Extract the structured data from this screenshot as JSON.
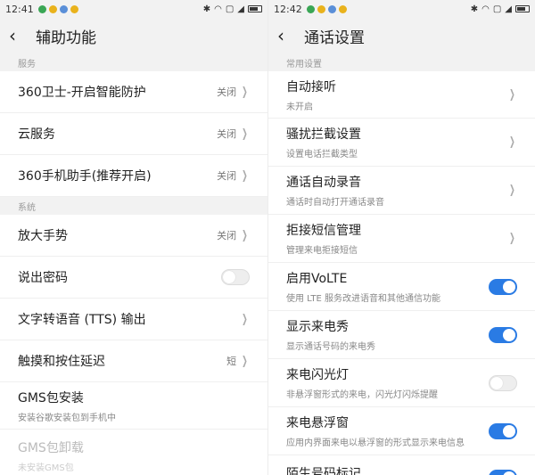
{
  "left": {
    "status": {
      "time": "12:41"
    },
    "title": "辅助功能",
    "sections": {
      "services": "服务",
      "system": "系统"
    },
    "rows": {
      "guard360": {
        "label": "360卫士-开启智能防护",
        "value": "关闭"
      },
      "cloud": {
        "label": "云服务",
        "value": "关闭"
      },
      "assistant360": {
        "label": "360手机助手(推荐开启)",
        "value": "关闭"
      },
      "magnify": {
        "label": "放大手势",
        "value": "关闭"
      },
      "speak_password": {
        "label": "说出密码",
        "toggle": false
      },
      "tts": {
        "label": "文字转语音 (TTS) 输出"
      },
      "touch_delay": {
        "label": "触摸和按住延迟",
        "value": "短"
      },
      "gms_install": {
        "label": "GMS包安装",
        "sub": "安装谷歌安装包到手机中"
      },
      "gms_uninstall": {
        "label": "GMS包卸载",
        "sub": "未安装GMS包"
      }
    }
  },
  "right": {
    "status": {
      "time": "12:42"
    },
    "title": "通话设置",
    "sections": {
      "common": "常用设置"
    },
    "rows": {
      "auto_answer": {
        "label": "自动接听",
        "sub": "未开启"
      },
      "harass": {
        "label": "骚扰拦截设置",
        "sub": "设置电话拦截类型"
      },
      "auto_record": {
        "label": "通话自动录音",
        "sub": "通话时自动打开通话录音"
      },
      "reject_sms": {
        "label": "拒接短信管理",
        "sub": "管理来电拒接短信"
      },
      "volte": {
        "label": "启用VoLTE",
        "sub": "使用 LTE 服务改进语音和其他通信功能",
        "toggle": true
      },
      "caller_show": {
        "label": "显示来电秀",
        "sub": "显示通话号码的来电秀",
        "toggle": true
      },
      "flash": {
        "label": "来电闪光灯",
        "sub": "非悬浮窗形式的来电，闪光灯闪烁提醒",
        "toggle": false
      },
      "float": {
        "label": "来电悬浮窗",
        "sub": "应用内界面来电以悬浮窗的形式显示来电信息",
        "toggle": true
      },
      "stranger": {
        "label": "陌生号码标记",
        "toggle": true
      }
    }
  },
  "icons": [
    "back-arrow-icon",
    "chevron-right-icon",
    "wifi-icon",
    "bluetooth-icon",
    "battery-icon"
  ],
  "colors": {
    "accent": "#2a7be4",
    "background": "#f2f2f2"
  }
}
